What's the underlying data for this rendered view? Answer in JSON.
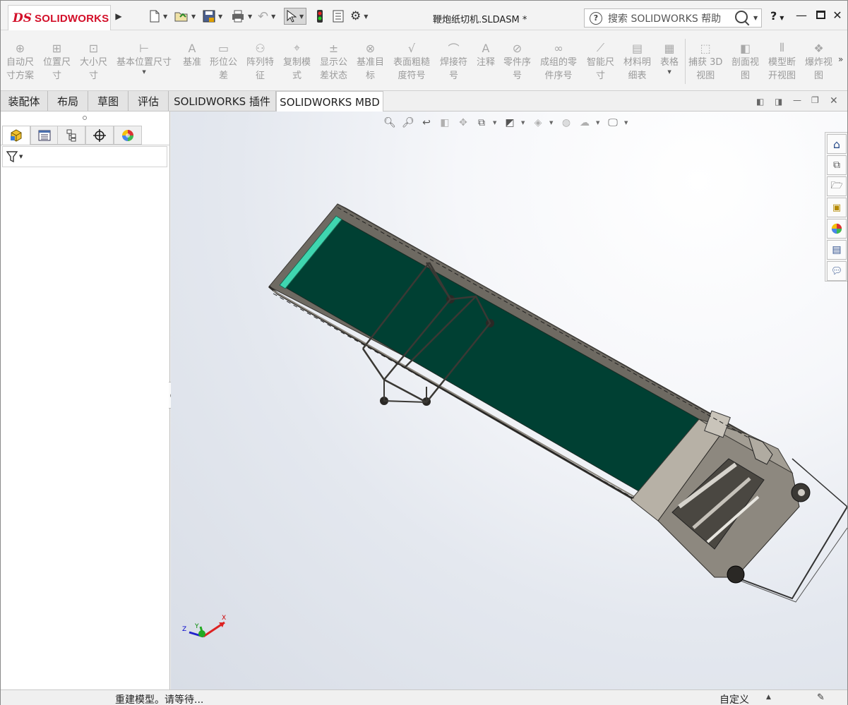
{
  "app": {
    "logo_ds": "DS",
    "logo_brand": "SOLIDWORKS",
    "doc_title": "鞭炮纸切机.SLDASM *"
  },
  "search": {
    "placeholder": "搜索 SOLIDWORKS 帮助"
  },
  "help": {
    "label": "?"
  },
  "ribbon": {
    "items": [
      {
        "label": "自动尺\n寸方案",
        "icon": "auto-dimension-icon"
      },
      {
        "label": "位置尺\n寸",
        "icon": "location-dimension-icon"
      },
      {
        "label": "大小尺\n寸",
        "icon": "size-dimension-icon"
      },
      {
        "label": "基本位置尺寸",
        "icon": "basic-location-dimension-icon"
      },
      {
        "label": "基准",
        "icon": "datum-icon"
      },
      {
        "label": "形位公\n差",
        "icon": "geometric-tolerance-icon"
      },
      {
        "label": "阵列特\n征",
        "icon": "pattern-feature-icon"
      },
      {
        "label": "复制模\n式",
        "icon": "copy-scheme-icon"
      },
      {
        "label": "显示公\n差状态",
        "icon": "show-tolerance-status-icon"
      },
      {
        "label": "基准目\n标",
        "icon": "datum-target-icon"
      },
      {
        "label": "表面粗糙\n度符号",
        "icon": "surface-finish-icon"
      },
      {
        "label": "焊接符\n号",
        "icon": "weld-symbol-icon"
      },
      {
        "label": "注释",
        "icon": "note-icon"
      },
      {
        "label": "零件序\n号",
        "icon": "balloon-icon"
      },
      {
        "label": "成组的零\n件序号",
        "icon": "stacked-balloon-icon"
      },
      {
        "label": "智能尺\n寸",
        "icon": "smart-dimension-icon"
      },
      {
        "label": "材料明\n细表",
        "icon": "bom-icon"
      },
      {
        "label": "表格",
        "icon": "table-icon"
      },
      {
        "label": "捕获 3D\n视图",
        "icon": "capture-3d-view-icon"
      },
      {
        "label": "剖面视\n图",
        "icon": "section-view-icon"
      },
      {
        "label": "模型断\n开视图",
        "icon": "model-break-view-icon"
      },
      {
        "label": "爆炸视\n图",
        "icon": "exploded-view-icon"
      }
    ]
  },
  "tabs": [
    {
      "label": "装配体"
    },
    {
      "label": "布局"
    },
    {
      "label": "草图"
    },
    {
      "label": "评估"
    },
    {
      "label": "SOLIDWORKS 插件"
    },
    {
      "label": "SOLIDWORKS MBD"
    }
  ],
  "status": {
    "message": "重建模型。请等待...",
    "unit_system": "自定义"
  },
  "colors": {
    "belt": "#004033",
    "frame": "#8c877e",
    "accent_red": "#d3102a"
  }
}
